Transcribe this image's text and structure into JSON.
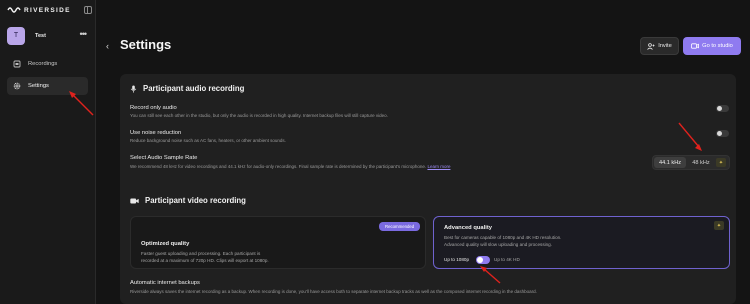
{
  "brand": {
    "name": "RIVERSIDE"
  },
  "workspace": {
    "avatar": "T",
    "name": "Test",
    "more": "•••"
  },
  "sidebar": {
    "items": [
      {
        "label": "Recordings",
        "icon": "recordings-icon"
      },
      {
        "label": "Settings",
        "icon": "gear-icon",
        "active": true
      }
    ]
  },
  "header": {
    "back": "‹",
    "title": "Settings",
    "invite_label": "Invite",
    "studio_label": "Go to studio"
  },
  "audio": {
    "title": "Participant audio recording",
    "record_only_audio": {
      "title": "Record only audio",
      "desc": "You can still see each other in the studio, but only the audio is recorded in high quality. Internet backup files will still capture video."
    },
    "noise_reduction": {
      "title": "Use noise reduction",
      "desc": "Reduce background noise such as AC fans, heaters, or other ambient sounds."
    },
    "sample_rate": {
      "title": "Select Audio Sample Rate",
      "desc": "We recommend 48 kHz for video recordings and 44.1 kHz for audio-only recordings. Final sample rate is determined by the participant's microphone.",
      "link": "Learn more",
      "option_a": "44.1 kHz",
      "option_b": "48 kHz"
    }
  },
  "video": {
    "title": "Participant video recording",
    "optimized": {
      "title": "Optimized quality",
      "line1": "Faster guest uploading and processing. Each participant is",
      "line2": "recorded at a maximum of 720p HD. Clips will export at 1080p.",
      "badge": "Recommended"
    },
    "advanced": {
      "title": "Advanced quality",
      "line1": "Best for cameras capable of 1080p and 4K HD resolution.",
      "line2": "Advanced quality will slow uploading and processing.",
      "res_left": "Up to 1080p",
      "res_right": "Up to 4K HD"
    }
  },
  "backups": {
    "title": "Automatic internet backups",
    "desc": "Riverside always saves the internet recording as a backup. When recording is done, you'll have access both to separate internet backup tracks as well as the composed internet recording in the dashboard."
  },
  "colors": {
    "accent": "#8f7bf0",
    "annotation": "#e0221d",
    "premium": "#e5c85a"
  }
}
